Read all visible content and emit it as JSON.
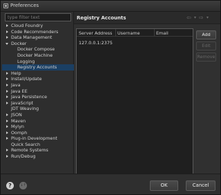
{
  "window": {
    "title": "Preferences"
  },
  "filter": {
    "placeholder": "type filter text"
  },
  "tree": [
    {
      "label": "Cloud Foundry",
      "arrow": "collapsed",
      "child": false,
      "selected": false
    },
    {
      "label": "Code Recommenders",
      "arrow": "collapsed",
      "child": false,
      "selected": false
    },
    {
      "label": "Data Management",
      "arrow": "collapsed",
      "child": false,
      "selected": false
    },
    {
      "label": "Docker",
      "arrow": "expanded",
      "child": false,
      "selected": false
    },
    {
      "label": "Docker Compose",
      "arrow": "none",
      "child": true,
      "selected": false
    },
    {
      "label": "Docker Machine",
      "arrow": "none",
      "child": true,
      "selected": false
    },
    {
      "label": "Logging",
      "arrow": "none",
      "child": true,
      "selected": false
    },
    {
      "label": "Registry Accounts",
      "arrow": "none",
      "child": true,
      "selected": true
    },
    {
      "label": "Help",
      "arrow": "collapsed",
      "child": false,
      "selected": false
    },
    {
      "label": "Install/Update",
      "arrow": "collapsed",
      "child": false,
      "selected": false
    },
    {
      "label": "Java",
      "arrow": "collapsed",
      "child": false,
      "selected": false
    },
    {
      "label": "Java EE",
      "arrow": "collapsed",
      "child": false,
      "selected": false
    },
    {
      "label": "Java Persistence",
      "arrow": "collapsed",
      "child": false,
      "selected": false
    },
    {
      "label": "JavaScript",
      "arrow": "collapsed",
      "child": false,
      "selected": false
    },
    {
      "label": "JDT Weaving",
      "arrow": "none",
      "child": false,
      "selected": false
    },
    {
      "label": "JSON",
      "arrow": "collapsed",
      "child": false,
      "selected": false
    },
    {
      "label": "Maven",
      "arrow": "collapsed",
      "child": false,
      "selected": false
    },
    {
      "label": "Mylyn",
      "arrow": "collapsed",
      "child": false,
      "selected": false
    },
    {
      "label": "Oomph",
      "arrow": "collapsed",
      "child": false,
      "selected": false
    },
    {
      "label": "Plug-in Development",
      "arrow": "collapsed",
      "child": false,
      "selected": false
    },
    {
      "label": "Quick Search",
      "arrow": "none",
      "child": false,
      "selected": false
    },
    {
      "label": "Remote Systems",
      "arrow": "collapsed",
      "child": false,
      "selected": false
    },
    {
      "label": "Run/Debug",
      "arrow": "collapsed",
      "child": false,
      "selected": false
    }
  ],
  "page": {
    "title": "Registry Accounts",
    "nav": {
      "back": "⇦",
      "back_menu": "▾",
      "forward": "⇨",
      "forward_menu": "▾"
    }
  },
  "table": {
    "headers": [
      "Server Address",
      "Username",
      "Email"
    ],
    "rows": [
      [
        "127.0.0.1:2375",
        "",
        ""
      ]
    ]
  },
  "buttons": {
    "add": "Add",
    "edit": "Edit",
    "remove": "Remove",
    "ok": "OK",
    "cancel": "Cancel"
  },
  "footer": {
    "help_glyph": "?",
    "import_glyph": "↓↑"
  }
}
